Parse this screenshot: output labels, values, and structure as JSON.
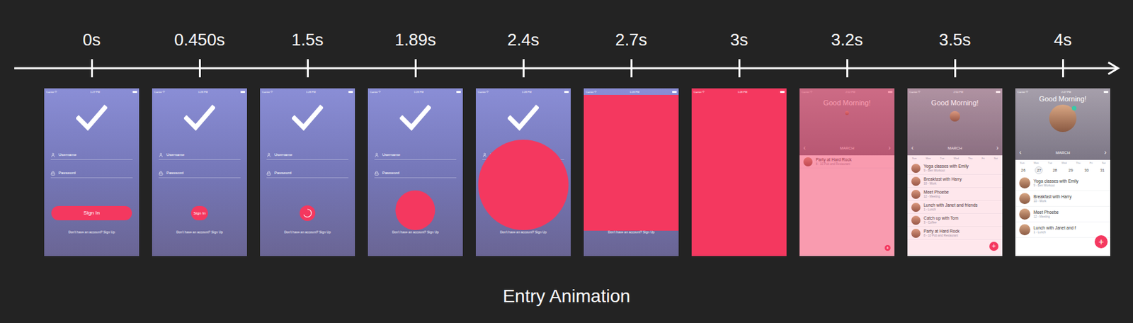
{
  "title": "Entry Animation",
  "status": {
    "carrier": "Carrier"
  },
  "login": {
    "username": "Username",
    "password": "Password",
    "sign_in": "Sign In",
    "signup": "Don't have an account? Sign Up"
  },
  "home": {
    "greeting": "Good Morning!",
    "month": "MARCH",
    "prev": "‹",
    "next": "›",
    "fab": "+",
    "weekdays": [
      "Sun",
      "Mon",
      "Tue",
      "Wed",
      "Thu",
      "Fri",
      "Sat"
    ],
    "days": [
      {
        "label": "26",
        "selected": false
      },
      {
        "label": "27",
        "selected": true
      },
      {
        "label": "28",
        "selected": false
      },
      {
        "label": "29",
        "selected": false
      },
      {
        "label": "30",
        "selected": false
      },
      {
        "label": "31",
        "selected": false
      }
    ]
  },
  "frames": [
    {
      "time": "0s",
      "kind": "login",
      "clock": "1:27 PM",
      "button": "full"
    },
    {
      "time": "0.450s",
      "kind": "login",
      "clock": "1:28 PM",
      "button": "pill"
    },
    {
      "time": "1.5s",
      "kind": "login",
      "clock": "1:28 PM",
      "button": "spinner"
    },
    {
      "time": "1.89s",
      "kind": "circle",
      "clock": "1:28 PM",
      "level": 0.42
    },
    {
      "time": "2.4s",
      "kind": "circle",
      "clock": "1:28 PM",
      "level": 0.95
    },
    {
      "time": "2.7s",
      "kind": "cover",
      "clock": "1:28 PM",
      "level": 0.81
    },
    {
      "time": "3s",
      "kind": "fill",
      "clock": "1:28 PM"
    },
    {
      "time": "3.2s",
      "kind": "home-enter",
      "clock": "2:52 PM",
      "overlay": 0.5,
      "events": [
        {
          "name": "Party at Hard Rock",
          "detail": "8 - 10 Pub and Restaurant"
        }
      ]
    },
    {
      "time": "3.5s",
      "kind": "home-mid",
      "clock": "2:50 PM",
      "overlay": 0.12,
      "events": [
        {
          "name": "Yoga classes with Emily",
          "detail": "9 - Ben Workout"
        },
        {
          "name": "Breakfast with Harry",
          "detail": "10 - Work"
        },
        {
          "name": "Meet Phoebe",
          "detail": "12 - Meeting"
        },
        {
          "name": "Lunch with Janet and friends",
          "detail": "1 - Lunch"
        },
        {
          "name": "Catch up with Tom",
          "detail": "3 - Coffee"
        },
        {
          "name": "Party at Hard Rock",
          "detail": "8 - 10 Pub and Restaurant"
        }
      ]
    },
    {
      "time": "4s",
      "kind": "home",
      "clock": "2:47 PM",
      "overlay": 0,
      "events": [
        {
          "name": "Yoga classes with Emily",
          "detail": "9 - Ben Workout"
        },
        {
          "name": "Breakfast with Harry",
          "detail": "10 - Work"
        },
        {
          "name": "Meet Phoebe",
          "detail": "12 - Meeting"
        },
        {
          "name": "Lunch with Janet and f",
          "detail": "1 - Lunch"
        }
      ]
    }
  ]
}
